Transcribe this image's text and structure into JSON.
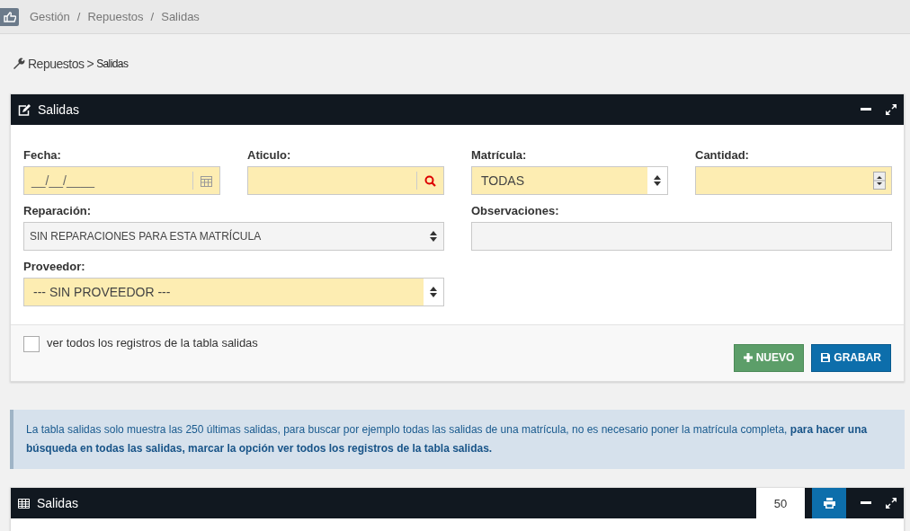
{
  "topbar": {
    "crumbs": [
      "Gestión",
      "/",
      "Repuestos",
      "/",
      "Salidas"
    ]
  },
  "breadcrumb": {
    "section": "Repuestos",
    "separator": ">",
    "page": "Salidas"
  },
  "form_panel": {
    "title": "Salidas",
    "top_fields": [
      {
        "label": "Fecha:",
        "kind": "date",
        "placeholder": "__/__/____",
        "highlighted": true
      },
      {
        "label": "Aticulo:",
        "kind": "search",
        "highlighted": true
      },
      {
        "label": "Matrícula:",
        "kind": "select",
        "value": "TODAS",
        "highlighted": true
      },
      {
        "label": "Cantidad:",
        "kind": "number",
        "highlighted": true
      }
    ],
    "left_fields": [
      {
        "label": "Reparación:",
        "kind": "select",
        "value": "SIN REPARACIONES PARA ESTA MATRÍCULA",
        "highlighted": false
      },
      {
        "label": "Proveedor:",
        "kind": "select",
        "value": "--- SIN PROVEEDOR ---",
        "highlighted": true
      }
    ],
    "right_fields": [
      {
        "label": "Observaciones:",
        "kind": "text",
        "highlighted": false
      }
    ],
    "checkbox": {
      "label": "ver todos los registros de la tabla salidas",
      "checked": false
    },
    "buttons": [
      {
        "label": "NUEVO",
        "kind": "new"
      },
      {
        "label": "GRABAR",
        "kind": "save"
      }
    ]
  },
  "info": "La tabla salidas solo muestra las 250 últimas salidas, para buscar por ejemplo todas las salidas de una matrícula, no es necesario poner la matrícula completa, **para hacer una búsqueda en todas las salidas, marcar la opción ver todos los registros de la tabla salidas.**",
  "table_panel": {
    "title": "Salidas",
    "page_size": "50"
  }
}
